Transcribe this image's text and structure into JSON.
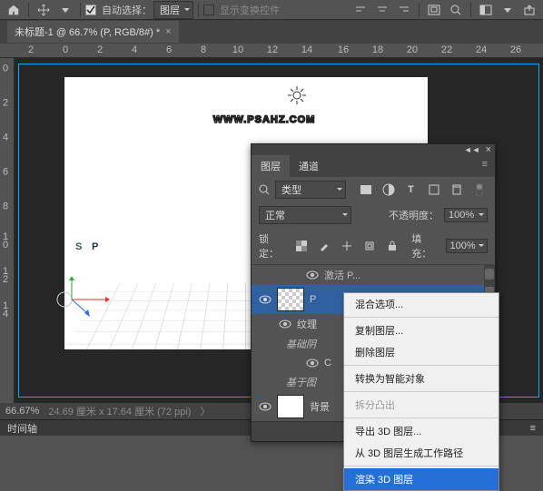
{
  "toolbar": {
    "auto_select_label": "自动选择：",
    "auto_select_dd": "图层",
    "show_transform": "显示变换控件"
  },
  "doc": {
    "tab_title": "未标题-1 @ 66.7% (P, RGB/8#) *"
  },
  "ruler_h": [
    "2",
    "0",
    "2",
    "4",
    "6",
    "8",
    "10",
    "12",
    "14",
    "16",
    "18",
    "20",
    "22",
    "24",
    "26"
  ],
  "ruler_v": [
    "0",
    "2",
    "4",
    "6",
    "8",
    "10",
    "12",
    "14"
  ],
  "canvas": {
    "watermark": "WWW.PSAHZ.COM",
    "big_p": "P",
    "big_s": "S"
  },
  "status": {
    "zoom": "66.67%",
    "dims": "24.69 厘米 x 17.64 厘米 (72 ppi)"
  },
  "timeline": {
    "label": "时间轴"
  },
  "panel": {
    "tab_layers": "图层",
    "tab_channels": "通道",
    "kind_dd": "类型",
    "blend_dd": "正常",
    "opacity_label": "不透明度：",
    "opacity_value": "100%",
    "lock_label": "锁定：",
    "fill_label": "填充：",
    "fill_value": "100%",
    "layer0_partial": "激活   P...",
    "layer1_name": "P",
    "layer2_name": "纹理",
    "group1": "基础阴",
    "group1_sub": "C",
    "group2": "基于图",
    "bg_label": "背景"
  },
  "ctx": {
    "blend_options": "混合选项...",
    "copy_layer": "复制图层...",
    "delete_layer": "删除图层",
    "convert_smart": "转换为智能对象",
    "split_extrude": "拆分凸出",
    "export_3d": "导出 3D 图层...",
    "gen_path": "从 3D 图层生成工作路径",
    "render_3d": "渲染 3D 图层"
  }
}
